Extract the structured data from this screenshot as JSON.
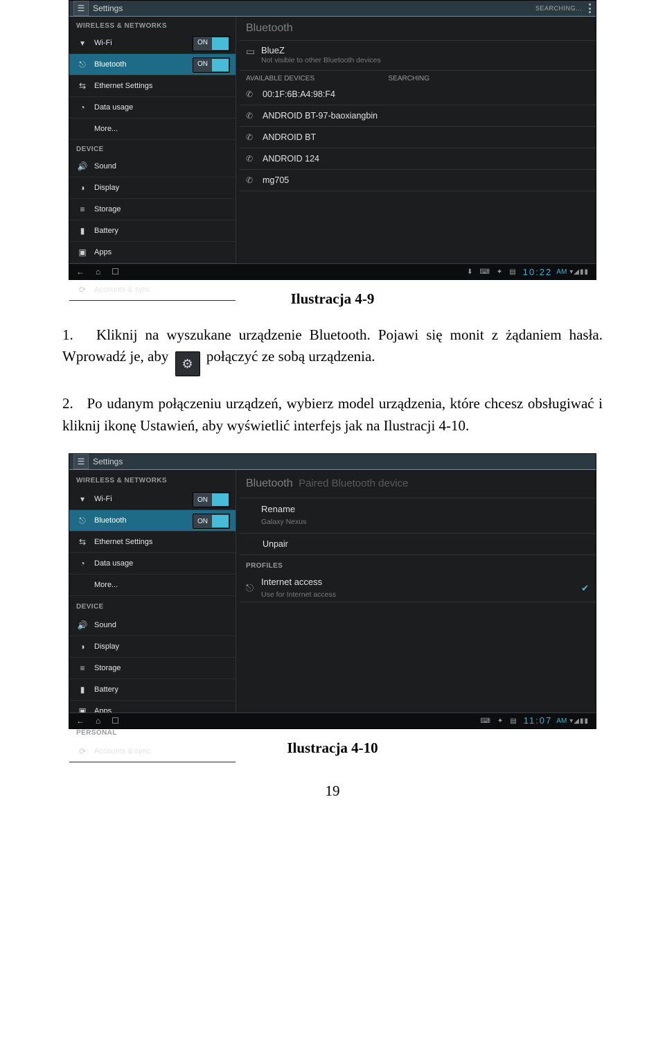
{
  "doc": {
    "caption1": "Ilustracja 4-9",
    "caption2": "Ilustracja 4-10",
    "list1_num": "1.",
    "list1a": "Kliknij na wyszukane urządzenie Bluetooth. Pojawi się monit z żądaniem hasła. Wprowadź je, aby ",
    "list1b": " połączyć ze sobą urządzenia.",
    "list2_num": "2.",
    "list2": "Po udanym połączeniu urządzeń, wybierz model urządzenia, które chcesz obsługiwać i kliknij ikonę Ustawień, aby wyświetlić interfejs jak na Ilustracji 4-10.",
    "page": "19"
  },
  "ui": {
    "title": "Settings",
    "searching_top": "SEARCHING...",
    "sections": {
      "wireless": "WIRELESS & NETWORKS",
      "device": "DEVICE",
      "personal": "PERSONAL"
    },
    "sidebar": {
      "wifi": "Wi-Fi",
      "bluetooth": "Bluetooth",
      "ethernet": "Ethernet Settings",
      "data": "Data usage",
      "more": "More...",
      "sound": "Sound",
      "display": "Display",
      "storage": "Storage",
      "battery": "Battery",
      "apps": "Apps",
      "accounts": "Accounts & sync"
    },
    "toggle_on": "ON",
    "right1": {
      "title": "Bluetooth",
      "own_name": "BlueZ",
      "own_sub": "Not visible to other Bluetooth devices",
      "avail_hdr": "AVAILABLE DEVICES",
      "searching": "SEARCHING",
      "devs": [
        "00:1F:6B:A4:98:F4",
        "ANDROID BT-97-baoxiangbin",
        "ANDROID BT",
        "ANDROID 124",
        "mg705"
      ]
    },
    "right2": {
      "title": "Bluetooth",
      "sub": "Paired Bluetooth device",
      "rename": "Rename",
      "rename_sub": "Galaxy Nexus",
      "unpair": "Unpair",
      "profiles_hdr": "PROFILES",
      "prof_name": "Internet access",
      "prof_sub": "Use for Internet access"
    },
    "nav1": {
      "time": "10:22",
      "ampm": "AM"
    },
    "nav2": {
      "time": "11:07",
      "ampm": "AM"
    }
  }
}
